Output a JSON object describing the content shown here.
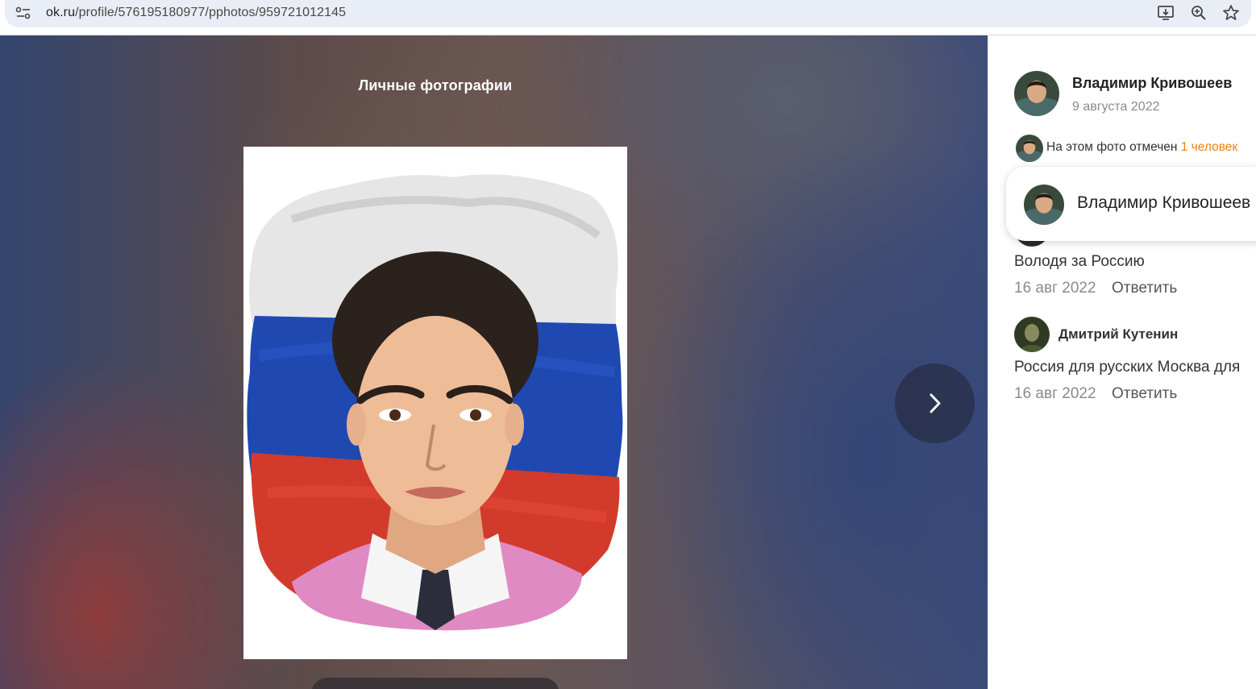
{
  "browser": {
    "url_host": "ok.ru",
    "url_path": "/profile/576195180977/pphotos/959721012145",
    "icons": [
      "site-info-icon",
      "install-icon",
      "zoom-icon",
      "bookmark-star-icon"
    ]
  },
  "viewer": {
    "album_title": "Личные фотографии",
    "next_icon": "chevron-right-icon"
  },
  "sidebar": {
    "author_name": "Владимир Кривошеев",
    "post_date": "9 августа 2022",
    "tagged_prefix": "На этом фото отмечен ",
    "tagged_link": "1 человек",
    "tag_popup_name": "Владимир Кривошеев",
    "comments": [
      {
        "text": "Володя за Россию",
        "date": "16 авг 2022",
        "reply": "Ответить"
      },
      {
        "author": "Дмитрий Кутенин",
        "text": "Россия для русских Москва для",
        "date": "16 авг 2022",
        "reply": "Ответить"
      }
    ]
  },
  "colors": {
    "link_orange": "#ee8208",
    "flag_white": "#e8e8e8",
    "flag_blue": "#1f49b0",
    "flag_red": "#d23a2c"
  }
}
